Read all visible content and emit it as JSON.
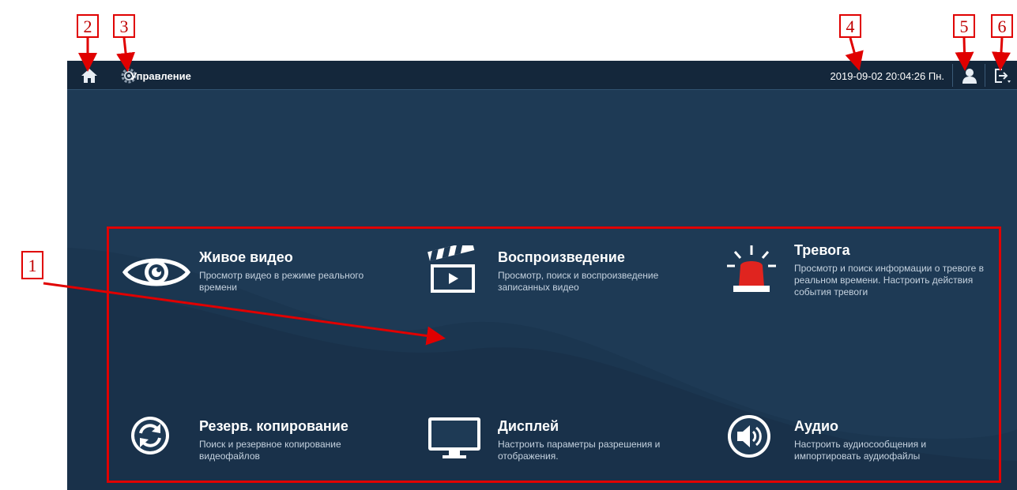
{
  "app": {
    "title": "Управление",
    "datetime": "2019-09-02 20:04:26 Пн."
  },
  "icons": {
    "home": "home-icon",
    "settings": "gear-icon",
    "user": "user-icon",
    "logout": "logout-icon"
  },
  "tiles": [
    {
      "title": "Живое видео",
      "description": "Просмотр видео в режиме реального времени",
      "icon": "eye-icon"
    },
    {
      "title": "Воспроизведение",
      "description": "Просмотр, поиск и воспроизведение записанных видео",
      "icon": "clapperboard-icon"
    },
    {
      "title": "Тревога",
      "description": "Просмотр и поиск информации о тревоге в реальном времени. Настроить действия события тревоги",
      "icon": "alarm-light-icon"
    },
    {
      "title": "Резерв. копирование",
      "description": "Поиск и резервное копирование видеофайлов",
      "icon": "sync-icon"
    },
    {
      "title": "Дисплей",
      "description": "Настроить параметры разрешения и отображения.",
      "icon": "monitor-icon"
    },
    {
      "title": "Аудио",
      "description": "Настроить аудиосообщения и импортировать аудиофайлы",
      "icon": "speaker-icon"
    }
  ],
  "callouts": [
    "1",
    "2",
    "3",
    "4",
    "5",
    "6"
  ],
  "colors": {
    "background": "#1e3a55",
    "topbar": "#14273b",
    "annotation": "#e00000",
    "alarm": "#e0241f"
  }
}
